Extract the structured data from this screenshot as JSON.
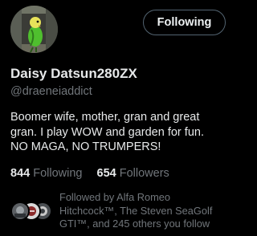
{
  "profile": {
    "display_name": "Daisy Datsun280ZX",
    "handle": "@draeneiaddict",
    "bio_lines": [
      "Boomer wife, mother, gran and great",
      "gran. I play WOW and garden for fun.",
      "NO MAGA, NO TRUMPERS!"
    ]
  },
  "follow_button": {
    "label": "Following"
  },
  "stats": {
    "following_count": "844",
    "following_label": "Following",
    "followers_count": "654",
    "followers_label": "Followers"
  },
  "followed_by": {
    "lines": [
      "Followed by Alfa Romeo",
      "Hitchcock™, The Steven SeaGolf",
      "GTI™, and 245 others you follow"
    ]
  },
  "icons": {
    "avatar": "budgie-photo",
    "facepile": [
      "follower-avatar-1",
      "follower-avatar-2",
      "follower-avatar-3"
    ]
  },
  "colors": {
    "background": "#000000",
    "primary_text": "#e7e9ea",
    "secondary_text": "#71767b",
    "button_border": "#536471"
  }
}
